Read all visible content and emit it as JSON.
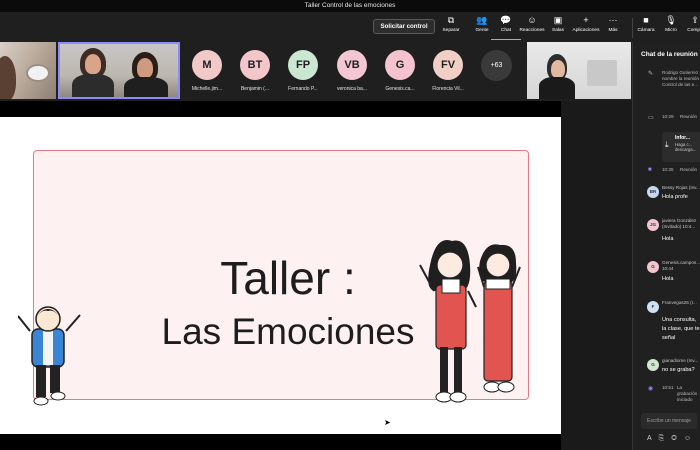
{
  "window": {
    "title": "Taller Control de las emociones"
  },
  "toolbar": {
    "request_control": "Solicitar control",
    "buttons": [
      {
        "icon": "pop-out-icon",
        "label": "Separar"
      },
      {
        "icon": "people-icon",
        "label": "Gente"
      },
      {
        "icon": "chat-icon",
        "label": "Chat"
      },
      {
        "icon": "reactions-icon",
        "label": "Reacciones"
      },
      {
        "icon": "rooms-icon",
        "label": "Salas"
      },
      {
        "icon": "apps-icon",
        "label": "Aplicaciones"
      },
      {
        "icon": "more-icon",
        "label": "Más"
      },
      {
        "icon": "camera-icon",
        "label": "Cámara"
      },
      {
        "icon": "mic-icon",
        "label": "Micro"
      },
      {
        "icon": "share-icon",
        "label": "Compa"
      }
    ]
  },
  "participants": [
    {
      "initials": "M",
      "name": "Michelle.jim...",
      "color": "#f2c9c9"
    },
    {
      "initials": "BT",
      "name": "Benjamin (...",
      "color": "#f3c6cb"
    },
    {
      "initials": "FP",
      "name": "Fernando P...",
      "color": "#c9e7d1"
    },
    {
      "initials": "VB",
      "name": "veronica ba...",
      "color": "#f3c6d3"
    },
    {
      "initials": "G",
      "name": "Genesis.ca...",
      "color": "#f4c3cf"
    },
    {
      "initials": "FV",
      "name": "Florencia Vil...",
      "color": "#f1cfc4"
    }
  ],
  "overflow_count": "+63",
  "slide": {
    "title_line1": "Taller :",
    "title_line2": "Las Emociones"
  },
  "chat": {
    "title": "Chat de la reunión",
    "sys_rename": "Rodrigo Gutierrez nombre la reunión Control de las e...",
    "sys_time1": "10:29",
    "sys_meeting1": "Reunión",
    "file_title": "Infor...",
    "file_text": "Haga c... descarga...",
    "sys_time2": "10:35",
    "sys_meeting2": "Reunión",
    "messages": [
      {
        "initials": "BR",
        "color": "#c7d6f0",
        "meta": "Bessy Rojas (Inv...",
        "text": "Hola profe"
      },
      {
        "initials": "JG",
        "color": "#f2c6d0",
        "meta": "javiera González (Invitado) 10:4...",
        "text": "Hola"
      },
      {
        "initials": "G",
        "color": "#f3c6cf",
        "meta": "Genesis.campos... 10:44",
        "text": "Hola"
      },
      {
        "initials": "F",
        "color": "#cfe2f1",
        "meta": "Franvegas25 (I...",
        "text": "Una consulta, la clase, que te señal"
      },
      {
        "initials": "G",
        "color": "#cfe7cf",
        "meta": "gianadiome (Inv...",
        "text": "no se graba?"
      }
    ],
    "sys_time3": "10:51",
    "sys_recording": "La grabación iniciado",
    "compose_placeholder": "Escribe un mensaje"
  }
}
